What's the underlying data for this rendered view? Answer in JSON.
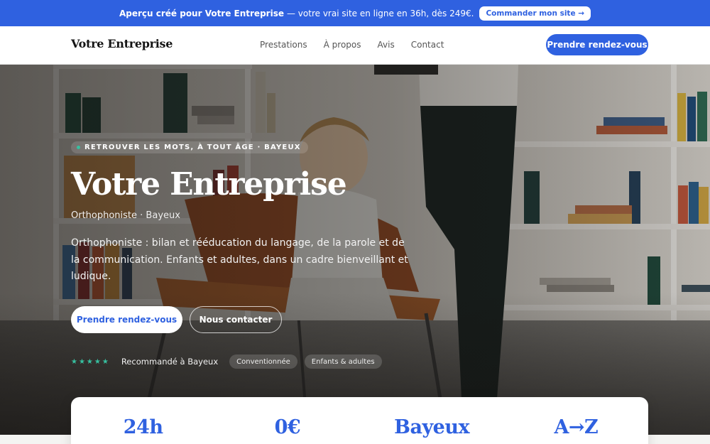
{
  "colors": {
    "accent": "#2f61e0",
    "teal": "#37c0a0"
  },
  "promo": {
    "strong": "Aperçu créé pour Votre Entreprise",
    "rest": "— votre vrai site en ligne en 36h, dès 249€.",
    "cta": "Commander mon site →"
  },
  "nav": {
    "brand": "Votre Entreprise",
    "links": [
      "Prestations",
      "À propos",
      "Avis",
      "Contact"
    ],
    "cta": "Prendre rendez-vous"
  },
  "hero": {
    "eyebrow": "RETROUVER LES MOTS, À TOUT ÂGE · BAYEUX",
    "title": "Votre Entreprise",
    "subtitle": "Orthophoniste · Bayeux",
    "description": "Orthophoniste : bilan et rééducation du langage, de la parole et de la communication. Enfants et adultes, dans un cadre bienveillant et ludique.",
    "primary_cta": "Prendre rendez-vous",
    "secondary_cta": "Nous contacter",
    "stars": "★★★★★",
    "trust_text": "Recommandé à Bayeux",
    "chips": [
      "Conventionnée",
      "Enfants & adultes"
    ]
  },
  "stats": [
    "24h",
    "0€",
    "Bayeux",
    "A→Z"
  ]
}
